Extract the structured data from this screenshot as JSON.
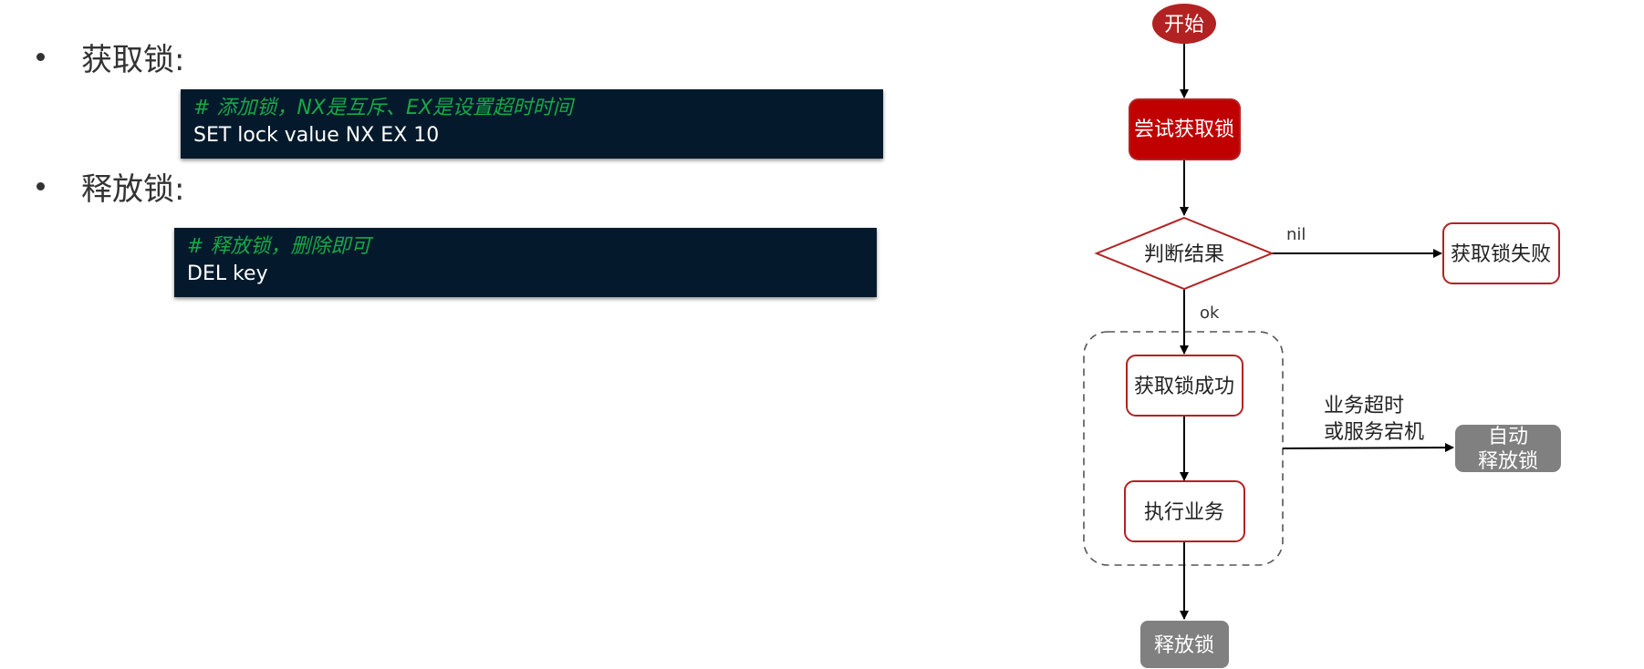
{
  "acquire": {
    "bullet": "获取锁:",
    "code_comment": "# 添加锁，NX是互斥、EX是设置超时时间",
    "code_line": "SET lock value NX EX 10"
  },
  "release": {
    "bullet": "释放锁:",
    "code_comment": "# 释放锁，删除即可",
    "code_line": "DEL key"
  },
  "flowchart": {
    "start": "开始",
    "try_acquire": "尝试获取锁",
    "judge": "判断结果",
    "nil_label": "nil",
    "fail": "获取锁失败",
    "ok_label": "ok",
    "success": "获取锁成功",
    "execute": "执行业务",
    "timeout_line1": "业务超时",
    "timeout_line2": "或服务宕机",
    "auto_line1": "自动",
    "auto_line2": "释放锁",
    "release": "释放锁"
  },
  "colors": {
    "code_bg": "#041a2c",
    "comment_green": "#18a846",
    "red_fill": "#c00000",
    "red_border": "#b22222",
    "gray_fill": "#808080"
  }
}
